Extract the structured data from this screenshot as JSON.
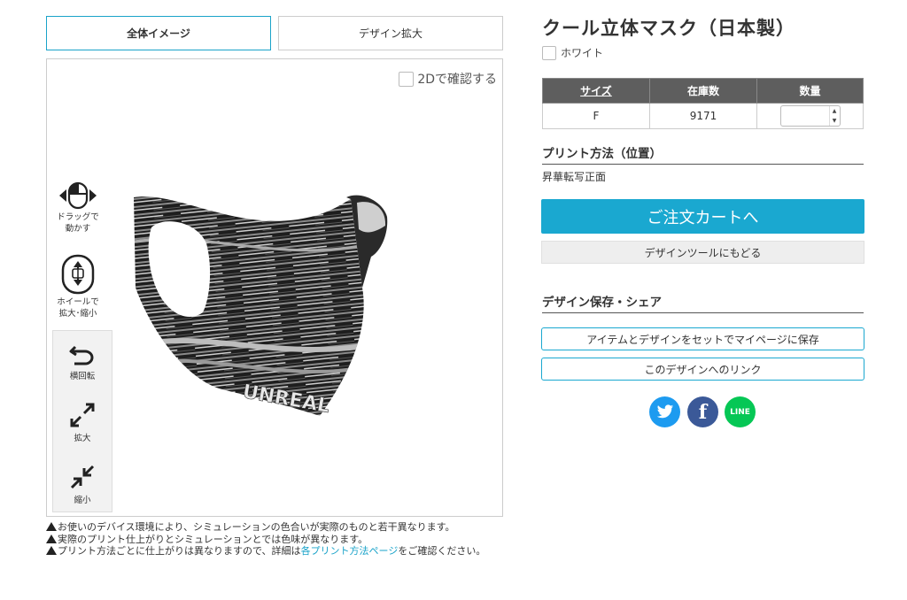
{
  "tabs": {
    "overall": "全体イメージ",
    "zoom": "デザイン拡大"
  },
  "viewer": {
    "check_2d": "2Dで確認する",
    "hint_drag": "ドラッグで\n動かす",
    "hint_wheel": "ホイールで\n拡大･縮小",
    "rotate": "横回転",
    "zoom_in": "拡大",
    "zoom_out": "縮小",
    "mask_print_text": "UNREAL"
  },
  "notes": {
    "n1": "お使いのデバイス環境により、シミュレーションの色合いが実際のものと若干異なります。",
    "n2": "実際のプリント仕上がりとシミュレーションとでは色味が異なります。",
    "n3_pre": "プリント方法ごとに仕上がりは異なりますので、詳細は",
    "n3_link": "各プリント方法ページ",
    "n3_post": "をご確認ください。"
  },
  "product": {
    "title": "クール立体マスク（日本製）",
    "color": "ホワイト"
  },
  "stock_table": {
    "headers": [
      "サイズ",
      "在庫数",
      "数量"
    ],
    "rows": [
      {
        "size": "F",
        "stock": "9171",
        "qty": ""
      }
    ]
  },
  "print": {
    "heading": "プリント方法（位置）",
    "value": "昇華転写正面"
  },
  "buttons": {
    "cart": "ご注文カートへ",
    "back": "デザインツールにもどる",
    "save": "アイテムとデザインをセットでマイページに保存",
    "link": "このデザインへのリンク"
  },
  "share": {
    "heading": "デザイン保存・シェア",
    "line_label": "LINE"
  },
  "colors": {
    "accent": "#1aa8d0",
    "table_header": "#5e5e5e",
    "twitter": "#1d9bf0",
    "facebook": "#3b5998",
    "line": "#06c755"
  }
}
